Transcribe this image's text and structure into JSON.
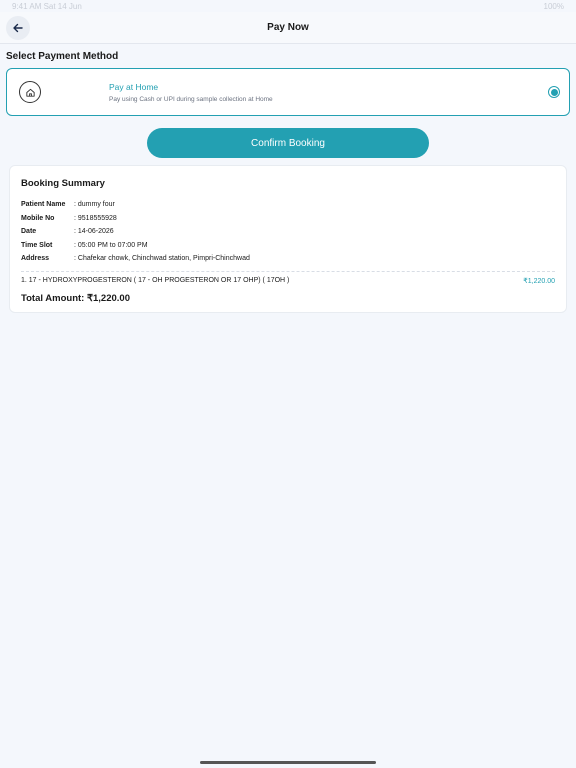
{
  "status_bar": {
    "time": "9:41 AM  Sat 14 Jun",
    "battery": "100%"
  },
  "app_bar": {
    "title": "Pay Now"
  },
  "payment": {
    "section_title": "Select Payment Method",
    "option_title": "Pay at Home",
    "option_desc": "Pay using Cash or UPI during sample collection at Home",
    "selected": true,
    "icon": "home-icon"
  },
  "confirm_label": "Confirm Booking",
  "summary": {
    "title": "Booking Summary",
    "rows": [
      {
        "label": "Patient Name",
        "value": ": dummy four"
      },
      {
        "label": "Mobile No",
        "value": ": 9518555928"
      },
      {
        "label": "Date",
        "value": ": 14-06-2026"
      },
      {
        "label": "Time Slot",
        "value": ": 05:00 PM to 07:00 PM"
      },
      {
        "label": "Address",
        "value": ": Chafekar chowk, Chinchwad station, Pimpri-Chinchwad"
      }
    ],
    "items": [
      {
        "name": "1. 17 - HYDROXYPROGESTERON ( 17 - OH PROGESTERON OR 17 OHP) ( 17OH )",
        "price": "₹1,220.00"
      }
    ],
    "total": "Total Amount: ₹1,220.00"
  },
  "colors": {
    "accent": "#23a0b2",
    "background": "#f4f7fc"
  }
}
